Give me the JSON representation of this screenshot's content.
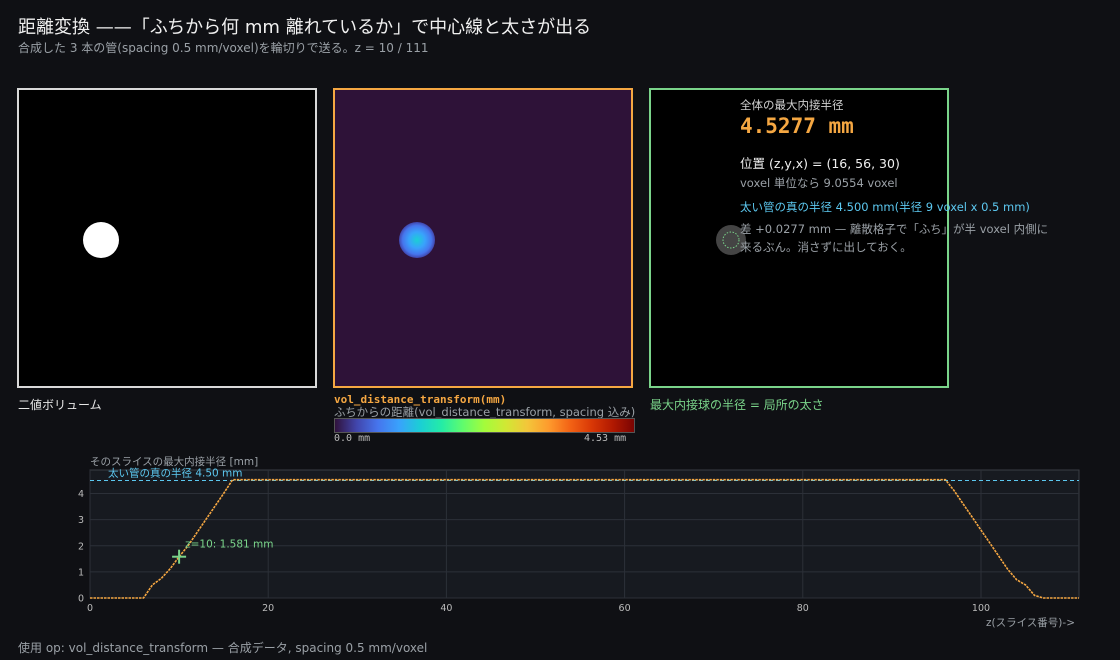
{
  "header": {
    "title": "距離変換 ——「ふちから何 mm 離れているか」で中心線と太さが出る",
    "subtitle": "合成した 3 本の管(spacing 0.5 mm/voxel)を輪切りで送る。z =  10 / 111"
  },
  "panels": {
    "binary_caption": "二値ボリューム",
    "dt_title": "vol_distance_transform(mm)",
    "dt_subtitle": "ふちからの距離(vol_distance_transform, spacing 込み)",
    "colorbar_min": "0.0 mm",
    "colorbar_max": "4.53 mm",
    "sphere_caption": "最大内接球の半径 = 局所の太さ"
  },
  "info": {
    "label": "全体の最大内接半径",
    "value": "4.5277 mm",
    "position": "位置 (z,y,x) = (16, 56, 30)",
    "voxel": "voxel 単位なら 9.0554 voxel",
    "true_radius": "太い管の真の半径 4.500 mm(半径 9 voxel x 0.5 mm)",
    "diff_line1": "差 +0.0277 mm — 離散格子で「ふち」が半 voxel 内側に",
    "diff_line2": "来るぶん。消さずに出しておく。"
  },
  "footer": "使用 op: vol_distance_transform  — 合成データ, spacing 0.5 mm/voxel",
  "colors": {
    "accent": "#f5a742",
    "green": "#7ad48a",
    "cyan": "#5cc8f0"
  },
  "chart_data": {
    "type": "line",
    "ylabel": "そのスライスの最大内接半径 [mm]",
    "xlabel": "z(スライス番号)->",
    "xlim": [
      0,
      111
    ],
    "ylim": [
      0,
      4.9
    ],
    "xticks": [
      0,
      20,
      40,
      60,
      80,
      100
    ],
    "yticks": [
      0,
      1,
      2,
      3,
      4
    ],
    "reference_line": {
      "y": 4.5,
      "label": "太い管の真の半径 4.50 mm"
    },
    "marker": {
      "x": 10,
      "y": 1.581,
      "label": "z=10: 1.581 mm"
    },
    "series": [
      {
        "x": [
          0,
          6,
          7,
          8,
          9,
          10,
          11,
          12,
          13,
          14,
          15,
          16,
          96,
          97,
          98,
          99,
          100,
          101,
          102,
          103,
          104,
          105,
          106,
          107,
          111
        ],
        "y": [
          0,
          0,
          0.5,
          0.75,
          1.12,
          1.581,
          2.0,
          2.5,
          3.0,
          3.5,
          4.0,
          4.5277,
          4.5277,
          4.1,
          3.6,
          3.1,
          2.6,
          2.1,
          1.6,
          1.1,
          0.7,
          0.5,
          0.1,
          0,
          0
        ]
      }
    ]
  }
}
